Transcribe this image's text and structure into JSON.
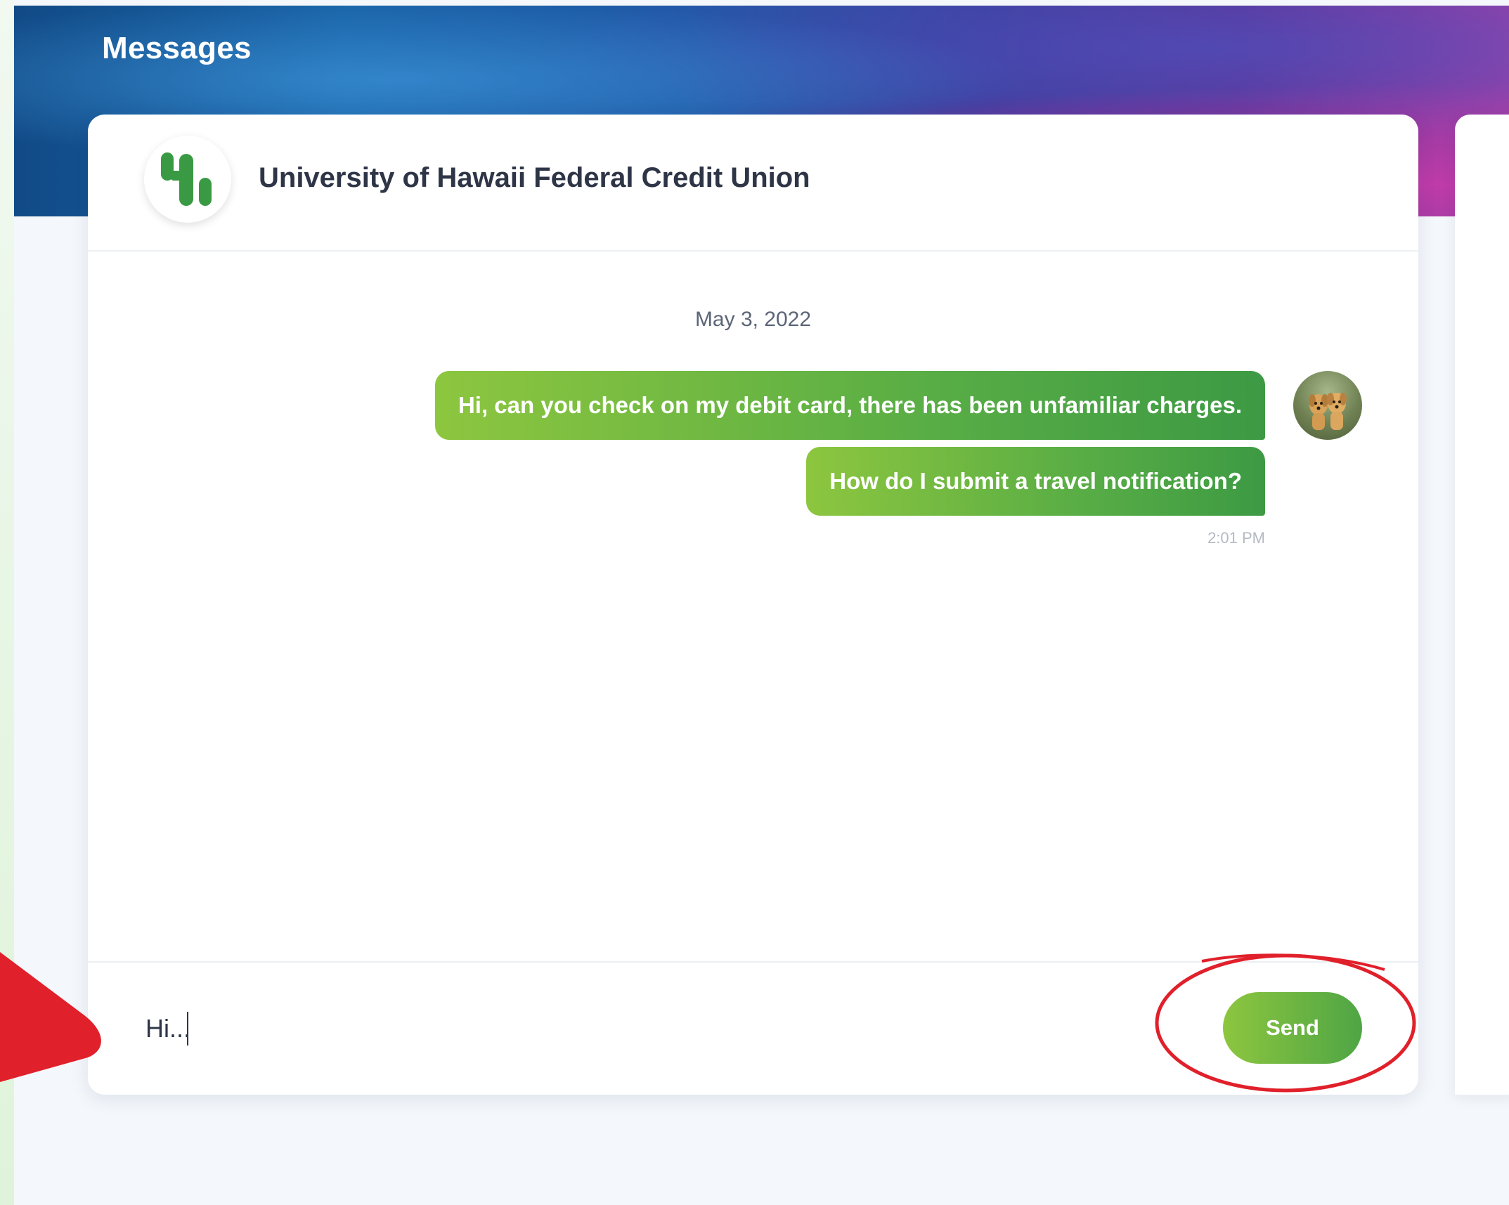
{
  "page": {
    "title": "Messages"
  },
  "conversation": {
    "institution_name": "University of Hawaii Federal Credit Union",
    "date_separator": "May 3, 2022",
    "messages": [
      {
        "text": "Hi, can you check on my debit card, there has been unfamiliar charges."
      },
      {
        "text": "How do I submit a travel notification?"
      }
    ],
    "timestamp": "2:01 PM"
  },
  "composer": {
    "value": "Hi...",
    "send_label": "Send"
  },
  "colors": {
    "brand_green": "#4fa545",
    "brand_green_light": "#8dc63f",
    "annotation_red": "#e0202a"
  }
}
